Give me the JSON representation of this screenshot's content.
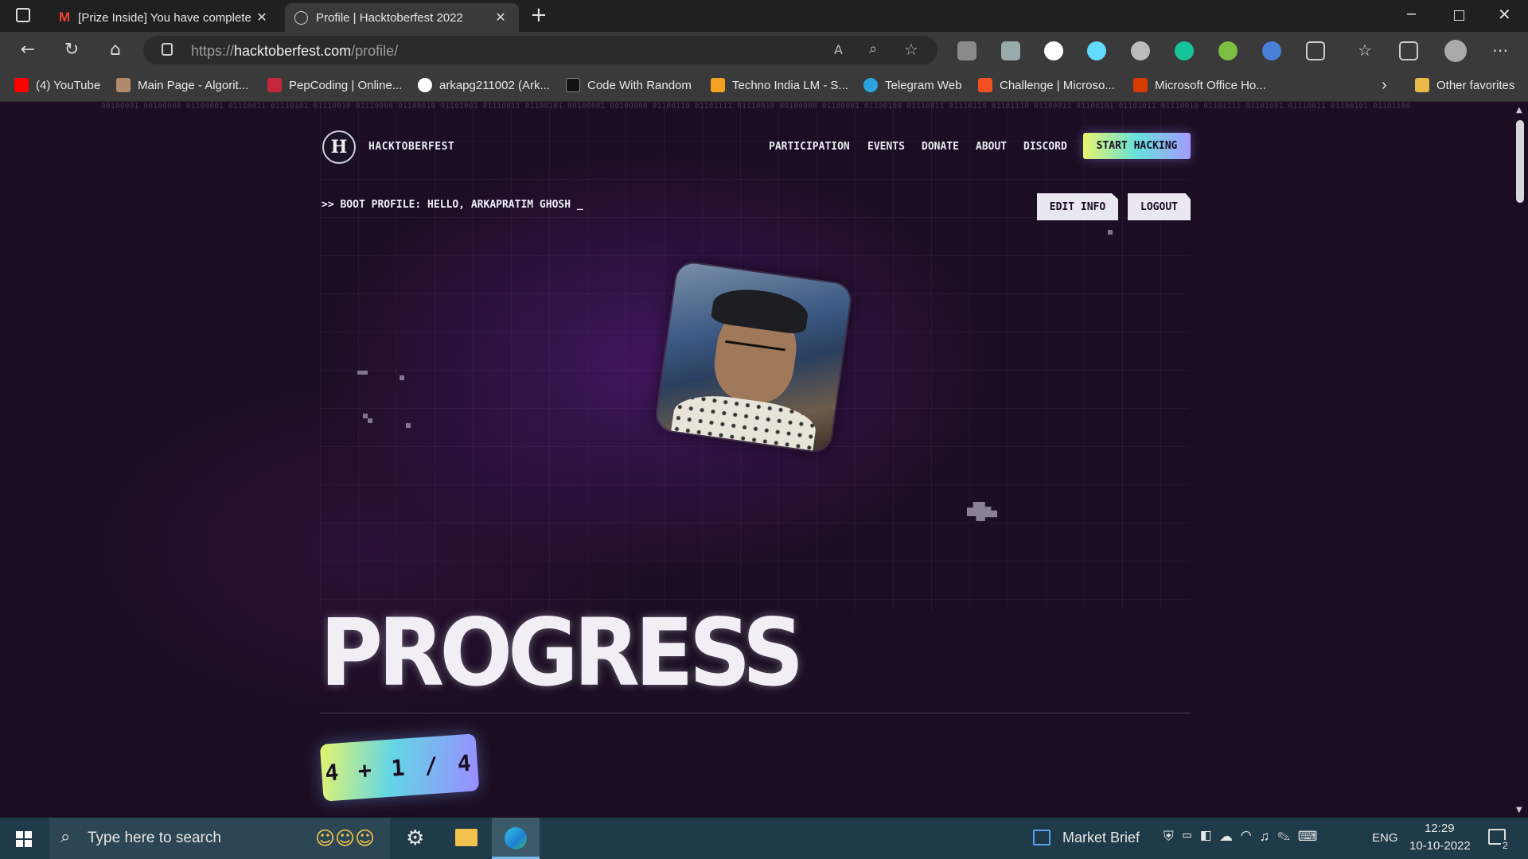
{
  "browser": {
    "tabs": [
      {
        "title": "[Prize Inside] You have complete",
        "icon": "gmail-icon"
      },
      {
        "title": "Profile | Hacktoberfest 2022",
        "icon": "globe-icon"
      }
    ],
    "url_prefix": "https://",
    "url_domain": "hacktoberfest.com",
    "url_path": "/profile/",
    "favorites": [
      {
        "label": "(4) YouTube",
        "color": "#ff0000"
      },
      {
        "label": "Main Page - Algorit...",
        "color": "#b08a6a"
      },
      {
        "label": "PepCoding | Online...",
        "color": "#c4283a"
      },
      {
        "label": "arkapg211002 (Ark...",
        "color": "#ffffff"
      },
      {
        "label": "Code With Random",
        "color": "#111111"
      },
      {
        "label": "Techno India LM - S...",
        "color": "#f2a21e"
      },
      {
        "label": "Telegram Web",
        "color": "#2aa3df"
      },
      {
        "label": "Challenge | Microso...",
        "color": "#f25022"
      },
      {
        "label": "Microsoft Office Ho...",
        "color": "#d83b01"
      }
    ],
    "other_favorites": "Other favorites"
  },
  "site": {
    "binary_strip": "00100001 00100000 01100001 01110011 01110101 01110010 01110000 01100010 01101001 01110011 01100101 00100001 00100000 01100110 01101111 01110010 00100000 01100001 01100100 01110011 01110110 01101110 01100011 01100101 01101011 01110010 01101111 01101001 01110011 01100101 01101100",
    "brand": "HACKTOBERFEST",
    "nav": [
      "PARTICIPATION",
      "EVENTS",
      "DONATE",
      "ABOUT",
      "DISCORD"
    ],
    "cta": "START HACKING",
    "boot_text": ">> BOOT PROFILE: HELLO, ARKAPRATIM GHOSH _",
    "edit_info": "EDIT INFO",
    "logout": "LOGOUT",
    "progress_heading": "PROGRESS",
    "score": "4 + 1 / 4",
    "colors": {
      "accent_yellow": "#e8f56d",
      "accent_cyan": "#67e0d9",
      "accent_purple": "#a59bff"
    }
  },
  "taskbar": {
    "search_placeholder": "Type here to search",
    "market": "Market Brief",
    "language": "ENG",
    "time": "12:29",
    "date": "10-10-2022",
    "notifications": "2"
  }
}
